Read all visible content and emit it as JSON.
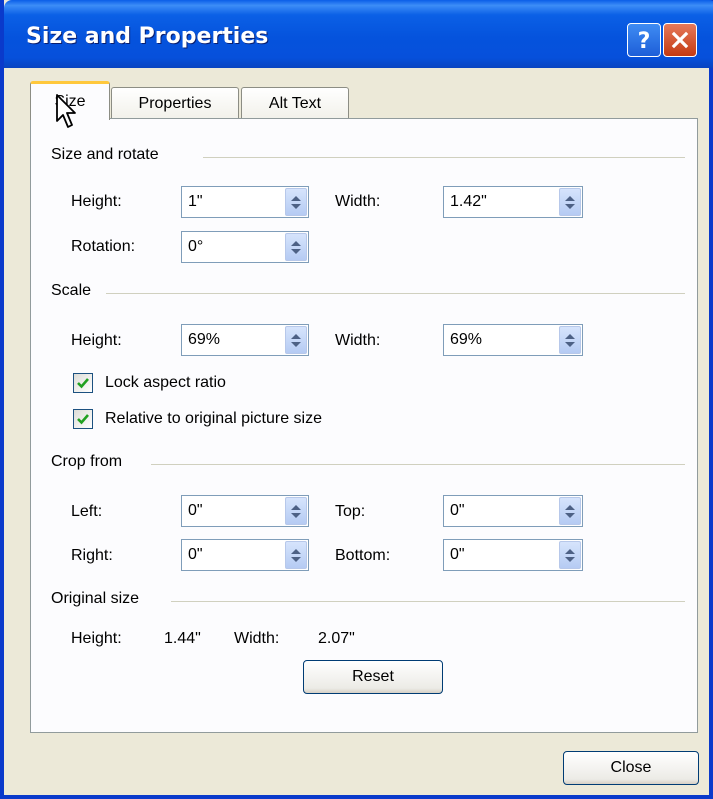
{
  "window": {
    "title": "Size and Properties"
  },
  "tabs": [
    {
      "label": "Size"
    },
    {
      "label": "Properties"
    },
    {
      "label": "Alt Text"
    }
  ],
  "size_rotate": {
    "title": "Size and rotate",
    "height_label": "Height:",
    "height_value": "1\"",
    "width_label": "Width:",
    "width_value": "1.42\"",
    "rotation_label": "Rotation:",
    "rotation_value": "0°"
  },
  "scale": {
    "title": "Scale",
    "height_label": "Height:",
    "height_value": "69%",
    "width_label": "Width:",
    "width_value": "69%",
    "lock_aspect_label": "Lock aspect ratio",
    "lock_aspect_checked": true,
    "relative_label": "Relative to original picture size",
    "relative_checked": true
  },
  "crop": {
    "title": "Crop from",
    "left_label": "Left:",
    "left_value": "0\"",
    "top_label": "Top:",
    "top_value": "0\"",
    "right_label": "Right:",
    "right_value": "0\"",
    "bottom_label": "Bottom:",
    "bottom_value": "0\""
  },
  "original_size": {
    "title": "Original size",
    "height_label": "Height:",
    "height_value": "1.44\"",
    "width_label": "Width:",
    "width_value": "2.07\"",
    "reset_label": "Reset"
  },
  "footer": {
    "close_label": "Close"
  },
  "colors": {
    "titlebar": "#0553DD",
    "dialog_bg": "#ECE9D8",
    "tab_highlight": "#FFC83C",
    "check": "#21A121"
  }
}
